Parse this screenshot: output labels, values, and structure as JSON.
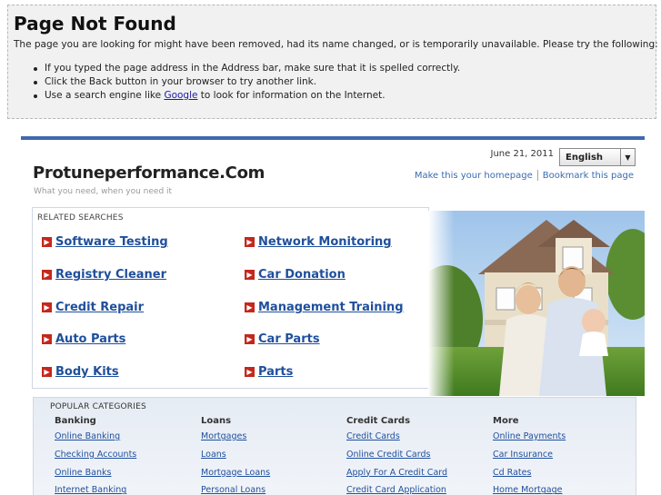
{
  "error": {
    "title": "Page Not Found",
    "description": "The page you are looking for might have been removed, had its name changed, or is temporarily unavailable. Please try the following:",
    "tips": [
      "If you typed the page address in the Address bar, make sure that it is spelled correctly.",
      "Click the Back button in your browser to try another link."
    ],
    "search_tip_prefix": "Use a search engine like ",
    "search_tip_link": "Google",
    "search_tip_suffix": " to look for information on the Internet."
  },
  "header": {
    "date": "June 21, 2011",
    "language": "English",
    "homepage_link": "Make this your homepage",
    "bookmark_link": "Bookmark this page",
    "site_title": "Protuneperformance.Com",
    "tagline": "What you need, when you need it"
  },
  "related": {
    "title": "RELATED SEARCHES",
    "left": [
      "Software Testing",
      "Registry Cleaner",
      "Credit Repair",
      "Auto Parts",
      "Body Kits"
    ],
    "right": [
      "Network Monitoring",
      "Car Donation",
      "Management Training",
      "Car Parts",
      "Parts"
    ]
  },
  "popular": {
    "title": "POPULAR CATEGORIES",
    "columns": [
      {
        "heading": "Banking",
        "links": [
          "Online Banking",
          "Checking Accounts",
          "Online Banks",
          "Internet Banking"
        ]
      },
      {
        "heading": "Loans",
        "links": [
          "Mortgages",
          "Loans",
          "Mortgage Loans",
          "Personal Loans"
        ]
      },
      {
        "heading": "Credit Cards",
        "links": [
          "Credit Cards",
          "Online Credit Cards",
          "Apply For A Credit Card",
          "Credit Card Application"
        ]
      },
      {
        "heading": "More",
        "links": [
          "Online Payments",
          "Car Insurance",
          "Cd Rates",
          "Home Mortgage"
        ]
      }
    ]
  },
  "colors": {
    "accent": "#3e6aac",
    "link": "#1f4f9c",
    "bullet": "#c4271c"
  }
}
